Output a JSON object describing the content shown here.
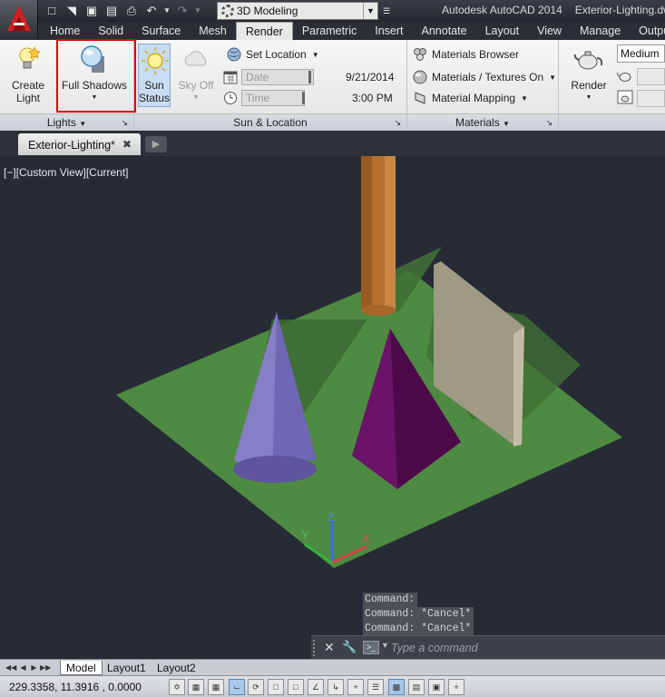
{
  "app_title": "Autodesk AutoCAD 2014",
  "file_title": "Exterior-Lighting.dwg",
  "quick_access": {
    "icons": [
      "new-icon",
      "open-icon",
      "save-icon",
      "saveas-icon",
      "plot-icon",
      "undo-icon",
      "redo-icon"
    ],
    "workspace": "3D Modeling"
  },
  "ribbon_tabs": [
    "Home",
    "Solid",
    "Surface",
    "Mesh",
    "Render",
    "Parametric",
    "Insert",
    "Annotate",
    "Layout",
    "View",
    "Manage",
    "Output"
  ],
  "active_tab": "Render",
  "lights_panel": {
    "title": "Lights",
    "create_light": [
      "Create",
      "Light"
    ],
    "full_shadows": "Full Shadows"
  },
  "sun_panel": {
    "title": "Sun & Location",
    "sun_status": [
      "Sun",
      "Status"
    ],
    "sky_off": "Sky Off",
    "set_location": "Set Location",
    "date_label": "Date",
    "date_value": "9/21/2014",
    "time_label": "Time",
    "time_value": "3:00 PM"
  },
  "materials_panel": {
    "title": "Materials",
    "browser": "Materials Browser",
    "textures": "Materials / Textures On",
    "mapping": "Material Mapping"
  },
  "render_panel": {
    "render": "Render",
    "quality": "Medium"
  },
  "document_tab": "Exterior-Lighting*",
  "viewport_label": "[−][Custom View][Current]",
  "ucs": {
    "x": "X",
    "y": "Y",
    "z": "Z"
  },
  "command_history": [
    "Command:",
    "Command: *Cancel*",
    "Command: *Cancel*"
  ],
  "command_placeholder": "Type a command",
  "layout_tabs": [
    "Model",
    "Layout1",
    "Layout2"
  ],
  "active_layout": "Model",
  "status": {
    "coordinates": "229.3358, 11.3916 , 0.0000"
  },
  "colors": {
    "viewport_bg": "#262b36",
    "ground": "#4f8a42",
    "cylinder": "#b5702f",
    "cone": "#6f66b4",
    "pyramid": "#5e0f5e",
    "wall": "#a09a85",
    "highlight": "#e00000"
  }
}
